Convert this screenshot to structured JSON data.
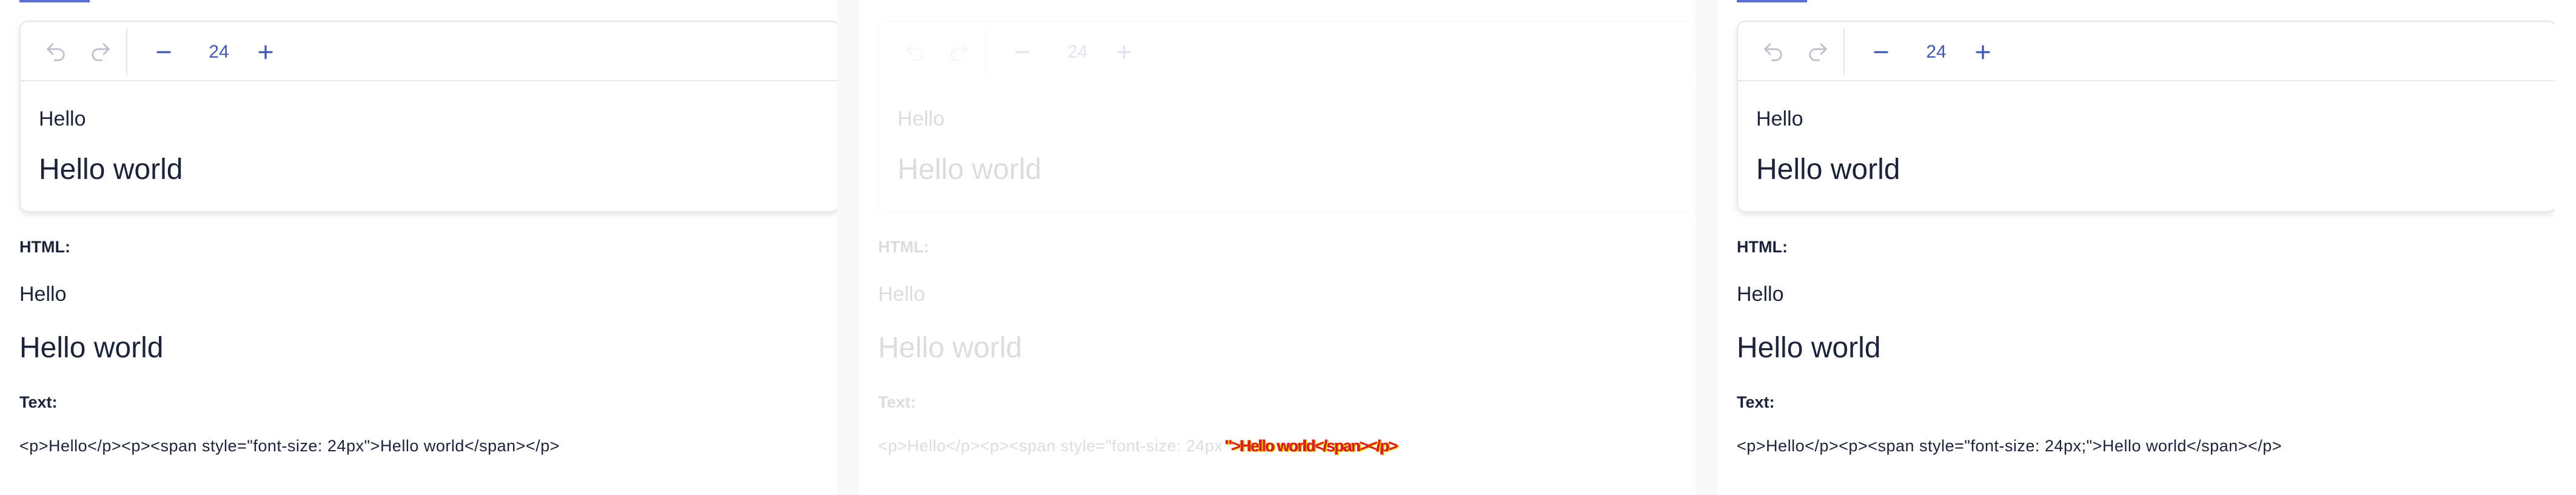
{
  "toolbar": {
    "font_size": "24"
  },
  "editor": {
    "paragraph1": "Hello",
    "paragraph2": "Hello world"
  },
  "labels": {
    "html": "HTML:",
    "text": "Text:"
  },
  "output": {
    "paragraph1": "Hello",
    "paragraph2": "Hello world"
  },
  "panels": [
    {
      "raw_text": "<p>Hello</p><p><span style=\"font-size: 24px\">Hello world</span></p>"
    },
    {
      "raw_text": "<p>Hello</p><p><span style=\"font-size: 24px",
      "glitch_text": "\">Hello world</span></p>"
    },
    {
      "raw_text": "<p>Hello</p><p><span style=\"font-size: 24px;\">Hello world</span></p>"
    }
  ],
  "colors": {
    "accent": "#4257b2",
    "text": "#1c2338",
    "border": "#e3e6ec",
    "glitch_red": "#d62020",
    "glitch_yellow": "#f4d200"
  },
  "icons": {
    "undo": "undo-icon",
    "redo": "redo-icon",
    "minus": "minus-icon",
    "plus": "plus-icon"
  }
}
